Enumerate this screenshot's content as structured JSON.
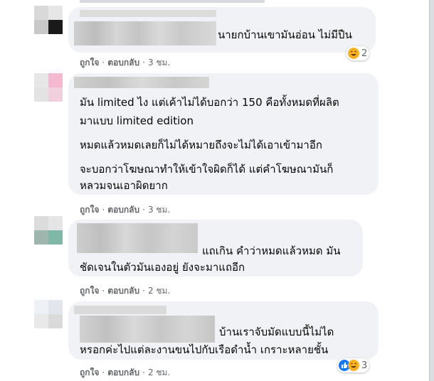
{
  "comments": [
    {
      "text_lines": [
        "นายกบ้านเขามันอ่อน ไม่มีปืน"
      ],
      "actions": {
        "like": "ถูกใจ",
        "reply": "ตอบกลับ",
        "time": "3 ชม."
      },
      "reaction_count": "2"
    },
    {
      "text_lines": [
        "มัน limited ไง แต่เค้าไม่ได้บอกว่า 150 คือทั้งหมดที่ผลิต",
        "มาแบบ limited edition",
        "หมดแล้วหมดเลยก็ไม่ได้หมายถึงจะไม่ได้เอาเข้ามาอีก",
        "จะบอกว่าโฆษณาทำให้เข้าใจผิดก็ได้ แต่คำโฆษณามันก็",
        "หลวมจนเอาผิดยาก"
      ],
      "actions": {
        "like": "ถูกใจ",
        "reply": "ตอบกลับ",
        "time": "3 ชม."
      }
    },
    {
      "text_lines": [
        "แถเกิน คำว่าหมดแล้วหมด มัน",
        "ชัดเจนในตัวมันเองอยู่ ยังจะมาแถอีก"
      ],
      "actions": {
        "like": "ถูกใจ",
        "reply": "ตอบกลับ",
        "time": "2 ชม."
      }
    },
    {
      "text_lines": [
        "บ้านเราจับมัดแบบนี้ไม่ได",
        "หรอกค่ะไปแต่ละงานขนไปกับเรือดำน้ำ เกราะหลายชั้น"
      ],
      "actions": {
        "like": "ถูกใจ",
        "reply": "ตอบกลับ",
        "time": "2 ชม."
      },
      "reaction_count": "3"
    }
  ],
  "colors": {
    "bubble": "#f0f2f5",
    "secondary_text": "#65676b",
    "like_blue": "#1877f2",
    "haha_yellow": "#f7b125",
    "blur_gray": "#d4d4d4"
  },
  "icons": [
    "haha-emoji-icon",
    "like-thumb-icon"
  ]
}
